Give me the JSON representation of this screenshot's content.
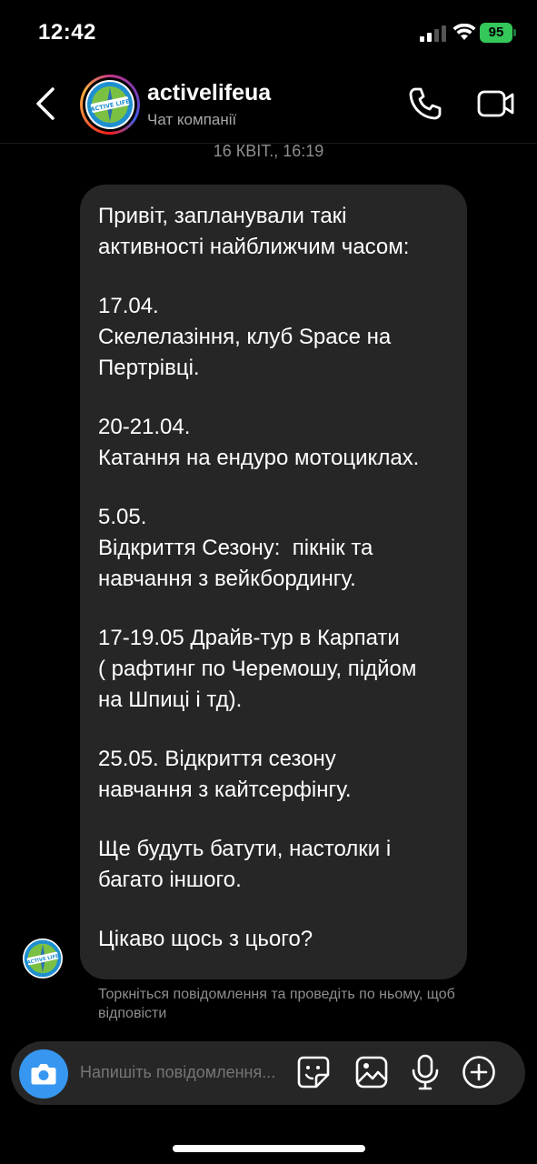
{
  "status_bar": {
    "time": "12:42",
    "battery": "95"
  },
  "header": {
    "title": "activelifeua",
    "subtitle": "Чат компанії",
    "avatar_logo_text": "ACTIVE LIFE"
  },
  "chat": {
    "timestamp": "16 КВІТ., 16:19",
    "message_lines": [
      [
        "Привіт, запланували такі",
        "активності найближчим часом:"
      ],
      [
        "17.04.",
        "Скелелазіння, клуб Space на",
        "Пертрівці."
      ],
      [
        "20-21.04.",
        "Катання на ендуро мотоциклах."
      ],
      [
        "5.05.",
        "Відкриття Сезону:  пікнік та",
        "навчання з вейкбордингу."
      ],
      [
        "17-19.05 Драйв-тур в Карпати",
        "( рафтинг по Черемошу, підйом",
        "на Шпиці і тд)."
      ],
      [
        "25.05. Відкриття сезону",
        "навчання з кайтсерфінгу."
      ],
      [
        "Ще будуть батути, настолки і",
        "багато іншого."
      ],
      [
        "Цікаво щось з цього?"
      ]
    ],
    "hint": "Торкніться повідомлення та проведіть по ньому, щоб відповісти"
  },
  "composer": {
    "placeholder": "Напишіть повідомлення..."
  },
  "colors": {
    "background": "#000000",
    "bubble": "#262626",
    "accent": "#3797f0",
    "battery": "#34c759",
    "muted_text": "#8e8e8e"
  },
  "icons": [
    "back-icon",
    "phone-icon",
    "video-icon",
    "camera-icon",
    "sticker-icon",
    "gallery-icon",
    "mic-icon",
    "add-icon",
    "signal-icon",
    "wifi-icon",
    "battery-icon"
  ]
}
